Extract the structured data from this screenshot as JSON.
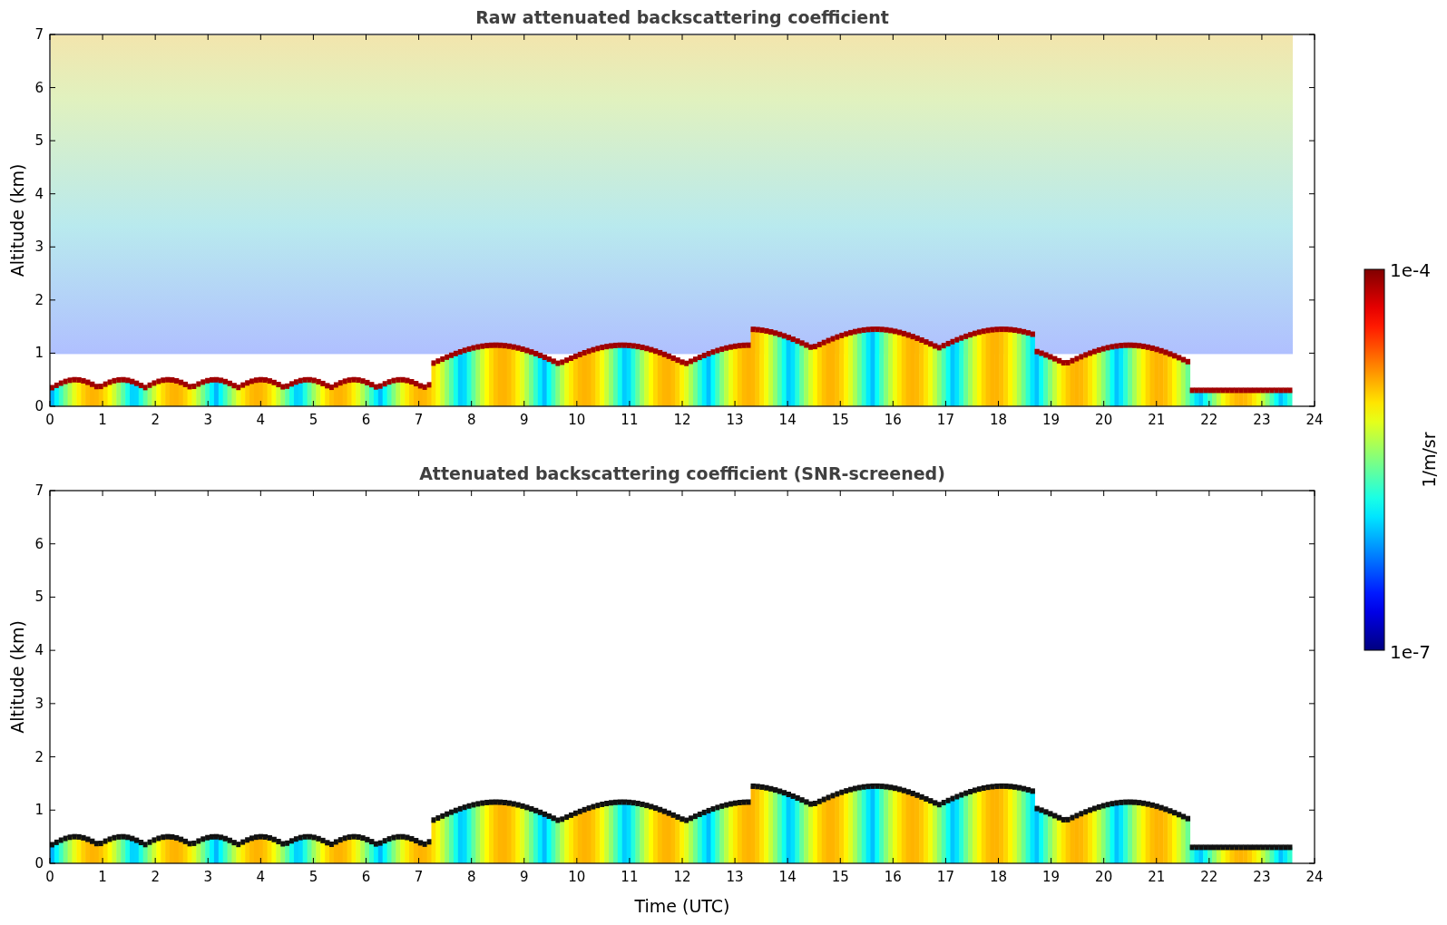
{
  "panels": [
    {
      "title": "Raw attenuated backscattering coefficient",
      "ylabel": "Altitude (km)",
      "yticks": [
        "7",
        "6",
        "5",
        "4",
        "3",
        "2",
        "1",
        "0"
      ],
      "xticks": [
        "0",
        "1",
        "2",
        "3",
        "4",
        "5",
        "6",
        "7",
        "8",
        "9",
        "10",
        "11",
        "12",
        "13",
        "14",
        "15",
        "16",
        "17",
        "18",
        "19",
        "20",
        "21",
        "22",
        "23",
        "24"
      ],
      "kind": "raw"
    },
    {
      "title": "Attenuated backscattering coefficient (SNR-screened)",
      "ylabel": "Altitude (km)",
      "xlabel": "Time (UTC)",
      "yticks": [
        "7",
        "6",
        "5",
        "4",
        "3",
        "2",
        "1",
        "0"
      ],
      "xticks": [
        "0",
        "1",
        "2",
        "3",
        "4",
        "5",
        "6",
        "7",
        "8",
        "9",
        "10",
        "11",
        "12",
        "13",
        "14",
        "15",
        "16",
        "17",
        "18",
        "19",
        "20",
        "21",
        "22",
        "23",
        "24"
      ],
      "kind": "screened"
    }
  ],
  "colorbar": {
    "label": "1/m/sr",
    "max_label": "1e-4",
    "min_label": "1e-7"
  }
}
